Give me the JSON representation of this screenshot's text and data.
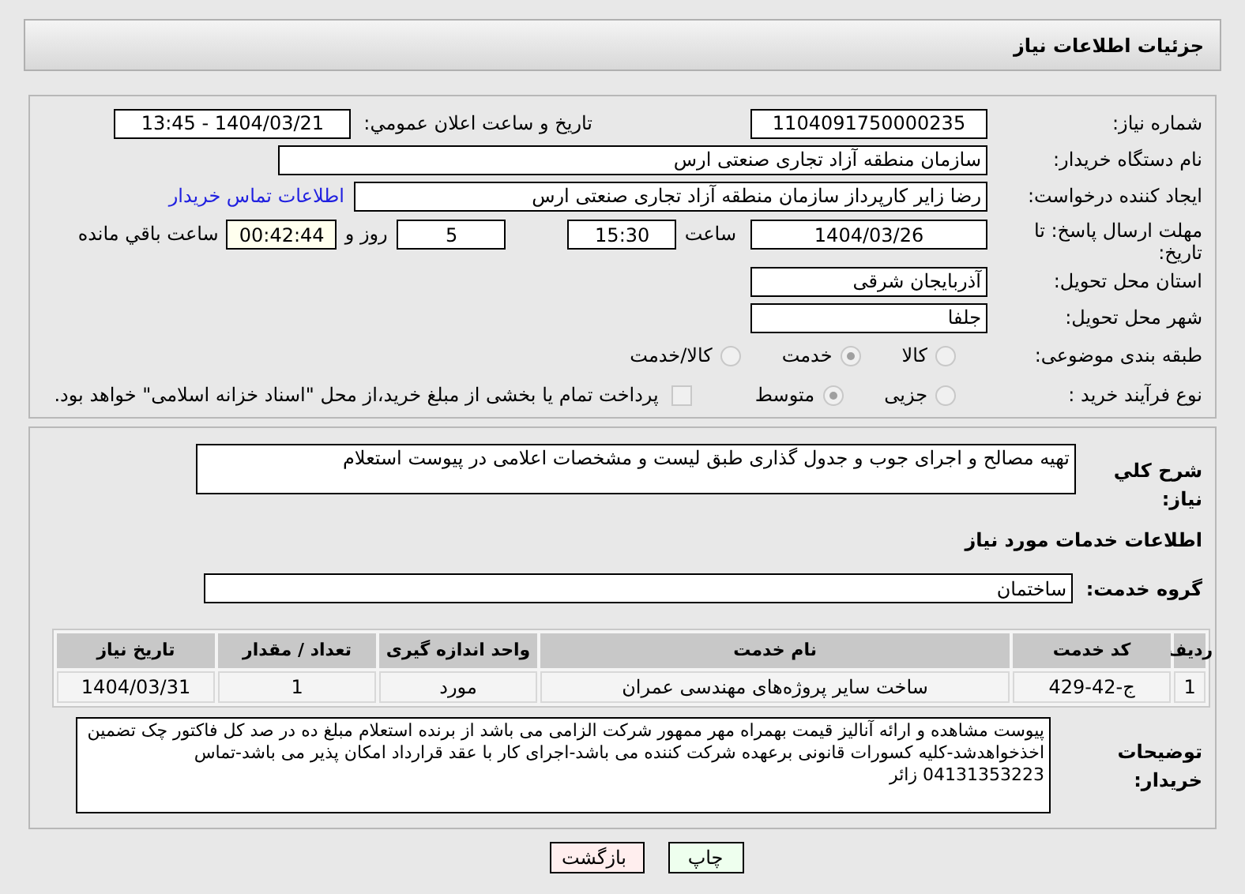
{
  "header": {
    "title": "جزئیات اطلاعات نیاز"
  },
  "details": {
    "need_number": {
      "label": "شماره نیاز:",
      "value": "1104091750000235"
    },
    "announce": {
      "label": "تاریخ و ساعت اعلان عمومي:",
      "value": "1404/03/21 - 13:45"
    },
    "buyer_org": {
      "label": "نام دستگاه خریدار:",
      "value": "سازمان منطقه آزاد تجاری صنعتی ارس"
    },
    "requester": {
      "label": "ایجاد کننده درخواست:",
      "value": "رضا زایر کارپرداز سازمان منطقه آزاد تجاری صنعتی ارس"
    },
    "contact_link": "اطلاعات تماس خریدار",
    "deadline": {
      "label": "مهلت ارسال پاسخ: تا تاریخ:",
      "date": "1404/03/26",
      "time_label": "ساعت",
      "time": "15:30",
      "days": "5",
      "days_label": "روز و",
      "remaining": "00:42:44",
      "remaining_label": "ساعت باقي مانده"
    },
    "province": {
      "label": "استان محل تحویل:",
      "value": "آذربایجان شرقی"
    },
    "city": {
      "label": "شهر محل تحویل:",
      "value": "جلفا"
    },
    "category": {
      "label": "طبقه بندی موضوعی:",
      "options": [
        {
          "label": "کالا",
          "selected": false
        },
        {
          "label": "خدمت",
          "selected": true
        },
        {
          "label": "کالا/خدمت",
          "selected": false
        }
      ]
    },
    "process": {
      "label": "نوع فرآیند خرید :",
      "options": [
        {
          "label": "جزیی",
          "selected": false
        },
        {
          "label": "متوسط",
          "selected": true
        }
      ],
      "payment": {
        "checked": false,
        "text": "پرداخت تمام یا بخشی از مبلغ خرید،از محل \"اسناد خزانه اسلامی\" خواهد بود."
      }
    }
  },
  "description": {
    "label": "شرح كلي نياز:",
    "value": "تهیه مصالح و اجرای جوب  و جدول گذاری طبق لیست و مشخصات اعلامی در پیوست استعلام"
  },
  "services_heading": "اطلاعات خدمات مورد نياز",
  "service_group": {
    "label": "گروه خدمت:",
    "value": "ساختمان"
  },
  "table": {
    "columns": [
      "ردیف",
      "کد خدمت",
      "نام خدمت",
      "واحد اندازه گیری",
      "تعداد / مقدار",
      "تاریخ نیاز"
    ],
    "rows": [
      [
        "1",
        "ج-42-429",
        "ساخت سایر پروژه‌های مهندسی عمران",
        "مورد",
        "1",
        "1404/03/31"
      ]
    ]
  },
  "buyer_notes": {
    "label": "توضیحات خریدار:",
    "value": "پیوست مشاهده و ارائه آنالیز قیمت بهمراه مهر ممهور شرکت الزامی می باشد از برنده استعلام مبلغ ده در صد کل فاکتور چک تضمین اخذخواهدشد-کلیه کسورات قانونی برعهده شرکت کننده می باشد-اجرای کار با عقد قرارداد امکان پذیر می باشد-تماس 04131353223 زائر"
  },
  "buttons": [
    {
      "label": "چاپ",
      "kind": "print"
    },
    {
      "label": "بازگشت",
      "kind": "back"
    }
  ]
}
